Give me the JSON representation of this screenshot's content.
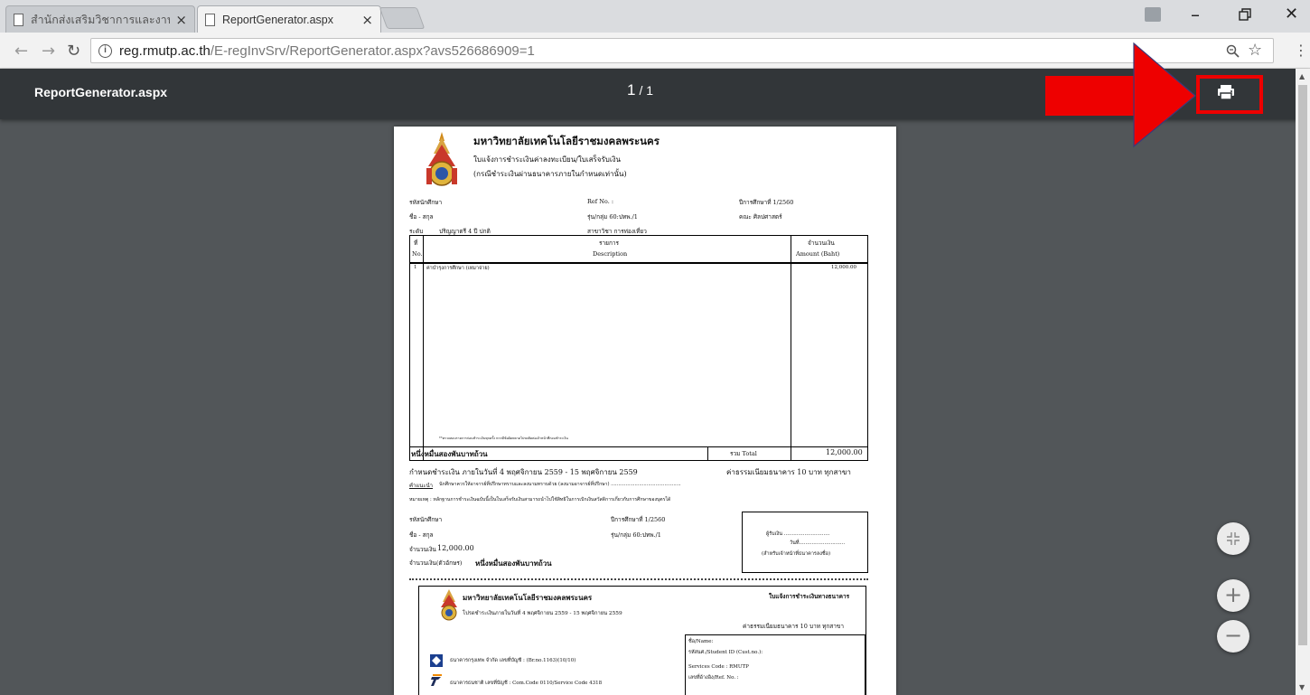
{
  "browser": {
    "tabs": [
      {
        "label": "สำนักส่งเสริมวิชาการและงานะ"
      },
      {
        "label": "ReportGenerator.aspx"
      }
    ],
    "tab_close_glyph": "×",
    "url_host": "reg.rmutp.ac.th",
    "url_path": "/E-regInvSrv/ReportGenerator.aspx?avs526686909=1"
  },
  "pdf_toolbar": {
    "title": "ReportGenerator.aspx",
    "page_current": "1",
    "page_total": "/ 1",
    "print_icon": "print-icon"
  },
  "highlight_color": "#ee0000",
  "document": {
    "university": "มหาวิทยาลัยเทคโนโลยีราชมงคลพระนคร",
    "subtitle1": "ใบแจ้งการชำระเงินค่าลงทะเบียน/ใบเสร็จรับเงิน",
    "subtitle2": "(กรณีชำระเงินผ่านธนาคารภายในกำหนดเท่านั้น)",
    "student_id_label": "รหัสนักศึกษา",
    "name_label": "ชื่อ - สกุล",
    "level_label": "ระดับ",
    "level_value": "ปริญญาตรี 4 ปี ปกติ",
    "ref_label": "Ref No. :",
    "group_label": "รุ่น/กลุ่ม  60:ปทพ./1",
    "major_label": "สาขาวิชา  การท่องเที่ยว",
    "year_label": "ปีการศึกษาที่  1/2560",
    "faculty_label": "คณะ  ศิลปศาสตร์",
    "col_no_th": "ที่",
    "col_no_en": "No.",
    "col_desc_th": "รายการ",
    "col_desc_en": "Description",
    "col_amt_th": "จำนวนเงิน",
    "col_amt_en": "Amount (Baht)",
    "item_no": "1",
    "item_desc": "ค่าบำรุงการศึกษา (เหมาจ่าย)",
    "item_amount": "12,000.00",
    "footnote": "**ตรวจสอบรายการก่อนชำระเงินทุกครั้ง หากมีข้อผิดพลาดโปรดติดต่อเจ้าหน้าที่ก่อนชำระเงิน",
    "total_words": "หนึ่งหมื่นสองพันบาทถ้วน",
    "total_label": "รวม Total",
    "total_amount": "12,000.00",
    "due_text": "กำหนดชำระเงิน ภายในวันที่  4 พฤศจิกายน 2559 - 15 พฤศจิกายน 2559",
    "fee_text": "ค่าธรรมเนียมธนาคาร 10 บาท ทุกสาขา",
    "advice_label": "คำแนะนำ",
    "advice_text": "นักศึกษาควรให้อาจารย์ที่ปรึกษาทราบและลงนามทราบด้วย (ลงนามอาจารย์ที่ปรึกษา) ...............................................",
    "note_text": "หมายเหตุ :  หลักฐานการชำระเงินฉบับนี้เป็นใบเสร็จรับเงินสามารถนำไปใช้สิทธิในการเบิกเงินสวัสดิการเกี่ยวกับการศึกษาของบุตรได้",
    "s_student_id_label": "รหัสนักศึกษา",
    "s_name_label": "ชื่อ - สกุล",
    "s_year_label": "ปีการศึกษาที่  1/2560",
    "s_group_label": "รุ่น/กลุ่ม  60:ปทพ./1",
    "s_amount_label": "จำนวนเงิน",
    "s_amount_value": "12,000.00",
    "s_words_label": "จำนวนเงิน(ตัวอักษร)",
    "s_words_value": "หนึ่งหมื่นสองพันบาทถ้วน",
    "receiver_label": "ผู้รับเงิน .............................",
    "date_label": "วันที่.............................",
    "officer_label": "(สำหรับเจ้าหน้าที่ธนาคารลงชื่อ)",
    "slip_title": "ใบแจ้งการชำระเงินทางธนาคาร",
    "slip_due": "โปรดชำระเงินภายในวันที่  4 พฤศจิกายน 2559 - 15 พฤศจิกายน 2559",
    "slip_fee": "ค่าธรรมเนียมธนาคาร 10 บาท ทุกสาขา",
    "bank1": "ธนาคารกรุงเทพ จำกัด เลขที่บัญชี : (Br.no.1163)(10/10)",
    "bank2": "ธนาคารธนชาติ เลขที่บัญชี : Com.Code 0110/Service Code 4318",
    "info_name": "ชื่อ/Name:",
    "info_student": "รหัสนศ./Student ID (Cust.no.):",
    "info_service": "Services Code  :  RMUTP",
    "info_ref": "เลขที่อ้างอิง/Ref. No. :"
  },
  "zoom": {
    "fit": "fit-page-icon",
    "in": "+",
    "out": "−"
  }
}
